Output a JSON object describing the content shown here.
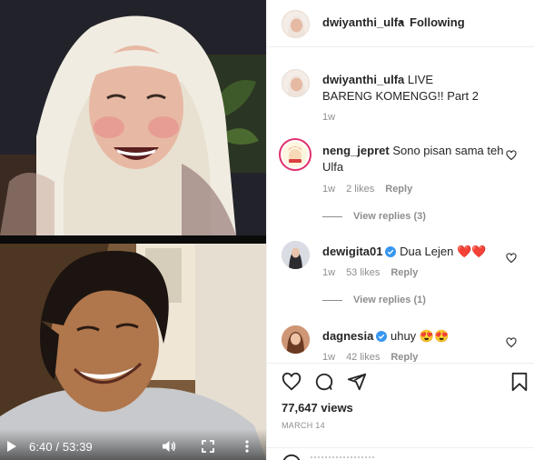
{
  "video": {
    "time": "6:40 / 53:39",
    "play_icon": "play-icon",
    "volume_icon": "volume-icon",
    "fullscreen_icon": "fullscreen-icon",
    "more_icon": "more-vertical-icon"
  },
  "header": {
    "username": "dwiyanthi_ulfa",
    "separator": "•",
    "follow_label": "Following"
  },
  "caption": {
    "username": "dwiyanthi_ulfa",
    "text": "LIVE BARENG KOMENGG!! Part 2",
    "age": "1w"
  },
  "comments": [
    {
      "username": "neng_jepret",
      "text": "Sono pisan sama teh Ulfa",
      "age": "1w",
      "likes": "2 likes",
      "reply": "Reply",
      "view_replies": "View replies (3)",
      "verified": false
    },
    {
      "username": "dewigita01",
      "text": "Dua Lejen ❤️❤️",
      "age": "1w",
      "likes": "53 likes",
      "reply": "Reply",
      "view_replies": "View replies (1)",
      "verified": true
    },
    {
      "username": "dagnesia",
      "text": "uhuy 😍😍",
      "age": "1w",
      "likes": "42 likes",
      "reply": "Reply",
      "verified": true
    }
  ],
  "actions": {
    "views": "77,647 views",
    "date": "MARCH 14"
  },
  "colors": {
    "text": "#262626",
    "muted": "#8e8e8e",
    "border": "#efefef",
    "verified": "#3897f0",
    "heart_red": "#ed4956"
  }
}
